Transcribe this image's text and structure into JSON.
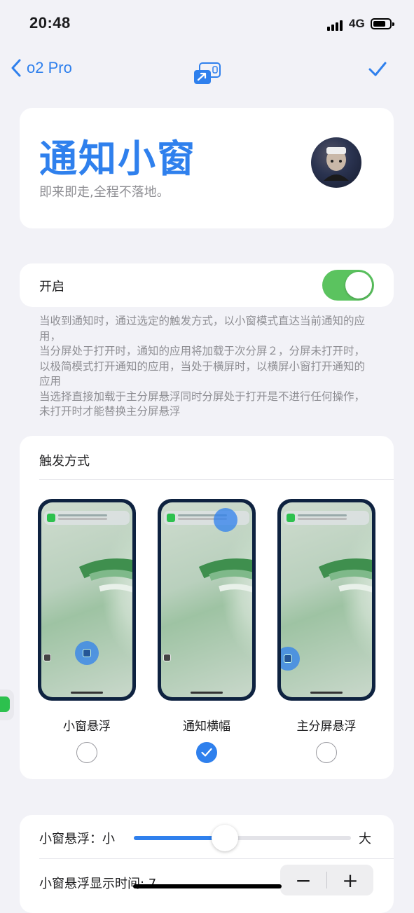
{
  "status_bar": {
    "time": "20:48",
    "network": "4G"
  },
  "nav": {
    "back_label": "o2 Pro"
  },
  "header": {
    "title": "通知小窗",
    "subtitle": "即来即走,全程不落地。"
  },
  "enable_row": {
    "label": "开启",
    "enabled": true
  },
  "description": [
    "当收到通知时，通过选定的触发方式，以小窗模式直达当前通知的应用，",
    "当分屏处于打开时，通知的应用将加载于次分屏２，分屏未打开时，以极简模式打开通知的应用，当处于横屏时，以横屏小窗打开通知的应用",
    "当选择直接加载于主分屏悬浮同时分屏处于打开是不进行任何操作，未打开时才能替换主分屏悬浮"
  ],
  "trigger": {
    "title": "触发方式",
    "options": [
      {
        "label": "小窗悬浮",
        "selected": false
      },
      {
        "label": "通知横幅",
        "selected": true
      },
      {
        "label": "主分屏悬浮",
        "selected": false
      }
    ]
  },
  "size_slider": {
    "label": "小窗悬浮：小",
    "max_label": "大",
    "value": 0.42
  },
  "duration": {
    "label": "小窗悬浮显示时间: 7",
    "minus": "−",
    "plus": "+"
  },
  "colors": {
    "accent": "#2f80ed",
    "toggle_on": "#5bc35f"
  }
}
